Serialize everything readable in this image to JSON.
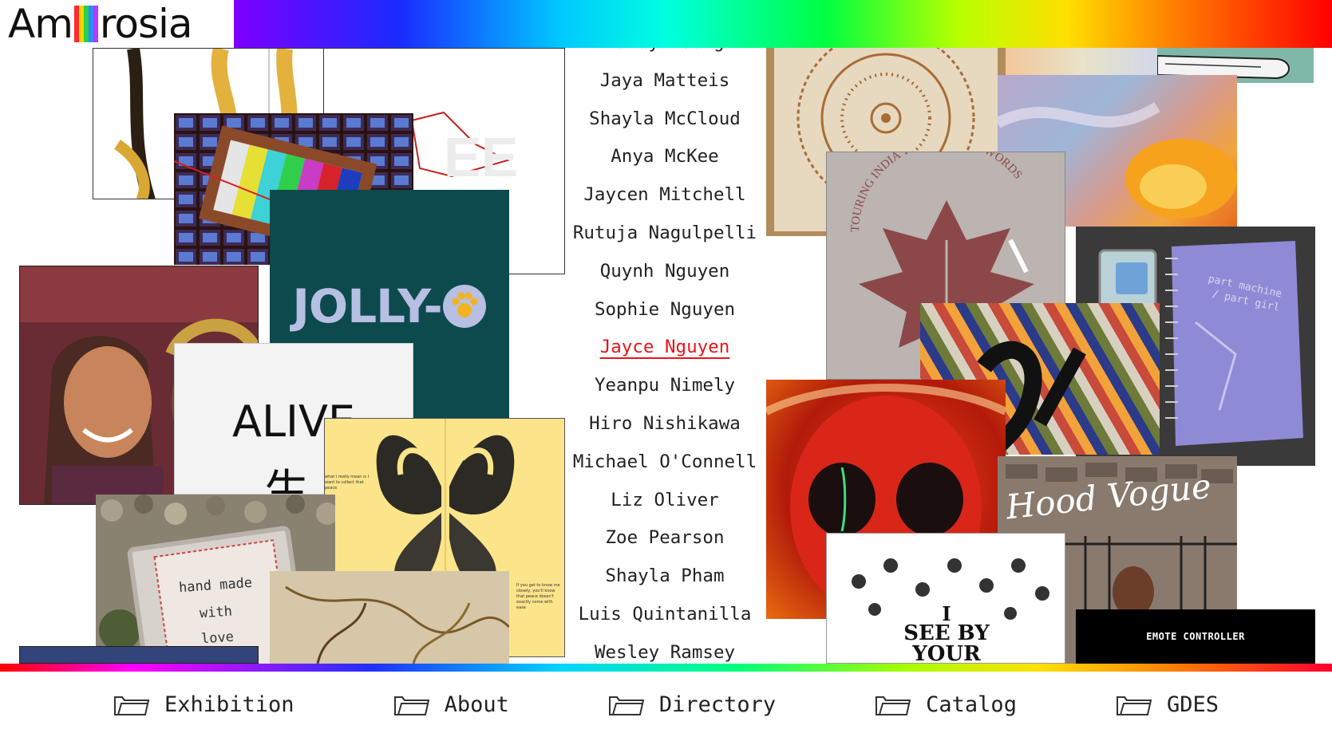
{
  "app": {
    "logo_text_left": "Am",
    "logo_text_right": "rosia"
  },
  "directory": {
    "active_index": 8,
    "names": [
      "Danaya Jung",
      "Jaya Matteis",
      "Shayla McCloud",
      "Anya McKee",
      "Jaycen Mitchell",
      "Rutuja Nagulpelli",
      "Quynh Nguyen",
      "Sophie Nguyen",
      "Jayce Nguyen",
      "Yeanpu Nimely",
      "Hiro Nishikawa",
      "Michael O'Connell",
      "Liz Oliver",
      "Zoe Pearson",
      "Shayla Pham",
      "Luis Quintanilla",
      "Wesley Ramsey"
    ]
  },
  "artworks": {
    "jolly": "JOLLY-",
    "alive_title": "ALIVE",
    "alive_glyph": "生",
    "butterfly_caption_1": "what i really mean is I want to collect that peace",
    "butterfly_caption_2": "If you get to know me closely, you'll know that peace doesn't exactly come with ease",
    "handmade_1": "hand made",
    "handmade_2": "with",
    "handmade_3": "love",
    "touring_arc": "TOURING INDIA THROUGH MY WORDS",
    "part_machine_1": "part machine",
    "part_machine_2": "/ part girl",
    "hood_vogue": "Hood Vogue",
    "see_by_1": "I",
    "see_by_2": "SEE BY",
    "see_by_3": "YOUR",
    "emote_controller": "EMOTE CONTROLLER"
  },
  "nav": {
    "items": [
      {
        "label": "Exhibition"
      },
      {
        "label": "About"
      },
      {
        "label": "Directory"
      },
      {
        "label": "Catalog"
      },
      {
        "label": "GDES"
      }
    ]
  },
  "colors": {
    "active_name": "#e8141a",
    "jolly_bg": "#0c4a4e",
    "jolly_text": "#b7bfe2",
    "butterfly_bg": "#fbe48a",
    "leaf_card_bg": "#bbb4b0",
    "leaf_color": "#8c4848",
    "emote_bg": "#000000"
  }
}
